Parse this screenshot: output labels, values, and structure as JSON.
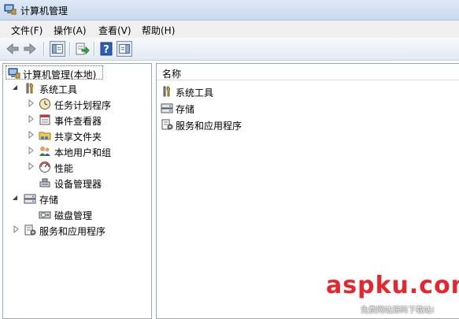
{
  "window": {
    "title": "计算机管理"
  },
  "menu": [
    "文件(F)",
    "操作(A)",
    "查看(V)",
    "帮助(H)"
  ],
  "tree": {
    "root": "计算机管理(本地)",
    "system_tools": "系统工具",
    "task_scheduler": "任务计划程序",
    "event_viewer": "事件查看器",
    "shared_folders": "共享文件夹",
    "local_users": "本地用户和组",
    "performance": "性能",
    "device_manager": "设备管理器",
    "storage": "存储",
    "disk_management": "磁盘管理",
    "services": "服务和应用程序"
  },
  "list": {
    "column_name": "名称",
    "items": [
      "系统工具",
      "存储",
      "服务和应用程序"
    ]
  },
  "watermark": {
    "main": "aspku.com",
    "sub": "免费网站源码下载站!"
  },
  "colors": {
    "accent": "#3399ff",
    "watermark": "#e8252c"
  }
}
